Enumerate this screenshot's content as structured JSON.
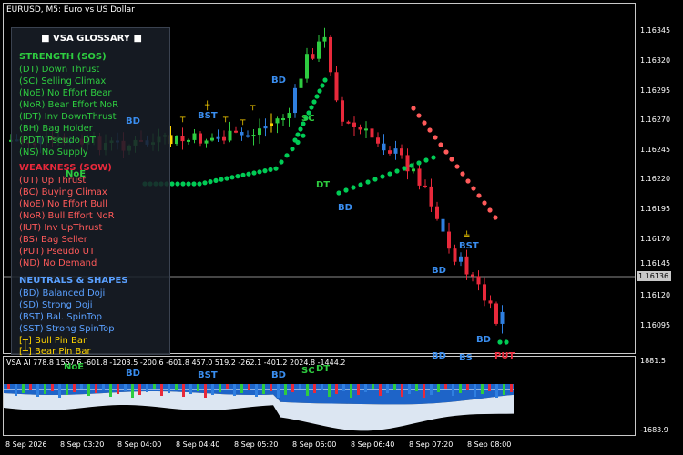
{
  "chart": {
    "title": "EURUSD, M5:  Euro vs US Dollar",
    "current_price": "1.16136",
    "price_ticks": [
      "1.16345",
      "1.16320",
      "1.16295",
      "1.16270",
      "1.16245",
      "1.16220",
      "1.16195",
      "1.16170",
      "1.16145",
      "1.16120",
      "1.16095"
    ],
    "time_ticks": [
      "8 Sep 2026",
      "8 Sep 03:20",
      "8 Sep 04:00",
      "8 Sep 04:40",
      "8 Sep 05:20",
      "8 Sep 06:00",
      "8 Sep 06:40",
      "8 Sep 07:20",
      "8 Sep 08:00"
    ],
    "colors": {
      "bull": "#2ecc40",
      "bear": "#e8293b",
      "neutral": "#2f7fe0",
      "doji": "#ffd400",
      "dots_up": "#00cc55",
      "dots_down": "#ff5a5a",
      "background": "#000000",
      "grid": "#c8c8c8"
    }
  },
  "glossary": {
    "title": "VSA GLOSSARY",
    "strength": {
      "heading": "STRENGTH (SOS)",
      "items": [
        "(DT)  Down Thrust",
        "(SC)  Selling Climax",
        "(NoE) No Effort Bear",
        "(NoR) Bear Effort NoR",
        "(IDT) Inv DownThrust",
        "(BH)  Bag Holder",
        "(PDT) Pseudo DT",
        "(NS)  No Supply"
      ]
    },
    "weakness": {
      "heading": "WEAKNESS (SOW)",
      "items": [
        "(UT)  Up Thrust",
        "(BC)  Buying Climax",
        "(NoE) No Effort Bull",
        "(NoR) Bull Effort NoR",
        "(IUT) Inv UpThrust",
        "(BS)  Bag Seller",
        "(PUT) Pseudo UT",
        "(ND)  No Demand"
      ]
    },
    "neutrals": {
      "heading": "NEUTRALS & SHAPES",
      "items": [
        "(BD)  Balanced Doji",
        "(SD)  Strong Doji",
        "(BST)  Bal. SpinTop",
        "(SST)  Strong SpinTop",
        "[┬] Bull Pin Bar",
        "[┴] Bear Pin Bar"
      ]
    }
  },
  "chart_labels": [
    {
      "text": "BD",
      "color": "#3a8ef0"
    },
    {
      "text": "BST",
      "color": "#3a8ef0"
    },
    {
      "text": "BD",
      "color": "#3a8ef0"
    },
    {
      "text": "SC",
      "color": "#2ecc40"
    },
    {
      "text": "NoE",
      "color": "#2ecc40"
    },
    {
      "text": "DT",
      "color": "#2ecc40"
    },
    {
      "text": "BD",
      "color": "#3a8ef0"
    },
    {
      "text": "BST",
      "color": "#3a8ef0"
    },
    {
      "text": "BD",
      "color": "#3a8ef0"
    },
    {
      "text": "BD",
      "color": "#3a8ef0"
    }
  ],
  "indicator": {
    "label": "VSA AI  778.8  1557.6  -601.8  -1203.5  -200.6  -601.8  457.0  519.2  -262.1  -401.2  2024.8  -1444.2",
    "max_tick": "1881.5",
    "min_tick": "-1683.9",
    "labels": [
      {
        "text": "NoE",
        "color": "#2ecc40"
      },
      {
        "text": "BD",
        "color": "#3a8ef0"
      },
      {
        "text": "BST",
        "color": "#3a8ef0"
      },
      {
        "text": "BD",
        "color": "#3a8ef0"
      },
      {
        "text": "SC",
        "color": "#2ecc40"
      },
      {
        "text": "DT",
        "color": "#2ecc40"
      },
      {
        "text": "BS",
        "color": "#3a8ef0"
      },
      {
        "text": "BD",
        "color": "#3a8ef0"
      },
      {
        "text": "PUT",
        "color": "#e8293b"
      }
    ]
  }
}
